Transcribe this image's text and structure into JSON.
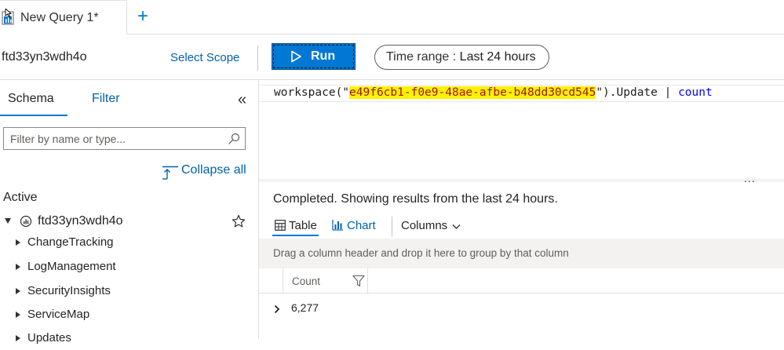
{
  "tab": {
    "title": "New Query 1*",
    "add_label": "+"
  },
  "toolbar": {
    "workspace_name": "ftd33yn3wdh4o",
    "select_scope_label": "Select Scope",
    "run_label": "Run",
    "time_range_prefix": "Time range : ",
    "time_range_value": "Last 24 hours"
  },
  "schema_pane": {
    "tabs": [
      {
        "label": "Schema"
      },
      {
        "label": "Filter"
      }
    ],
    "collapse_pane_glyph": "«",
    "filter_placeholder": "Filter by name or type...",
    "collapse_all_label": "Collapse all",
    "active_heading": "Active",
    "workspace": {
      "label": "ftd33yn3wdh4o",
      "items": [
        {
          "label": "ChangeTracking"
        },
        {
          "label": "LogManagement"
        },
        {
          "label": "SecurityInsights"
        },
        {
          "label": "ServiceMap"
        },
        {
          "label": "Updates"
        }
      ]
    }
  },
  "editor": {
    "prefix": "workspace(\"",
    "workspace_id": "e49f6cb1-f0e9-48ae-afbe-b48dd30cd545",
    "middle": "\").Update | ",
    "operator": "count",
    "more_glyph": "..."
  },
  "results": {
    "status": "Completed. Showing results from the last 24 hours.",
    "view_tabs": [
      {
        "label": "Table"
      },
      {
        "label": "Chart"
      }
    ],
    "columns_label": "Columns",
    "group_hint": "Drag a column header and drop it here to group by that column",
    "columns": [
      {
        "label": "Count"
      }
    ],
    "rows": [
      {
        "count": "6,277"
      }
    ]
  },
  "colors": {
    "accent": "#0078d4",
    "link": "#0062ad",
    "highlight": "#fff200",
    "string": "#a31515",
    "keyword": "#0000ff"
  },
  "icons": [
    "query-file-icon",
    "play-icon",
    "search-icon",
    "collapse-all-icon",
    "workspace-icon",
    "star-icon",
    "table-icon",
    "chart-icon",
    "chevron-down-icon",
    "funnel-icon",
    "chevron-right-icon"
  ]
}
